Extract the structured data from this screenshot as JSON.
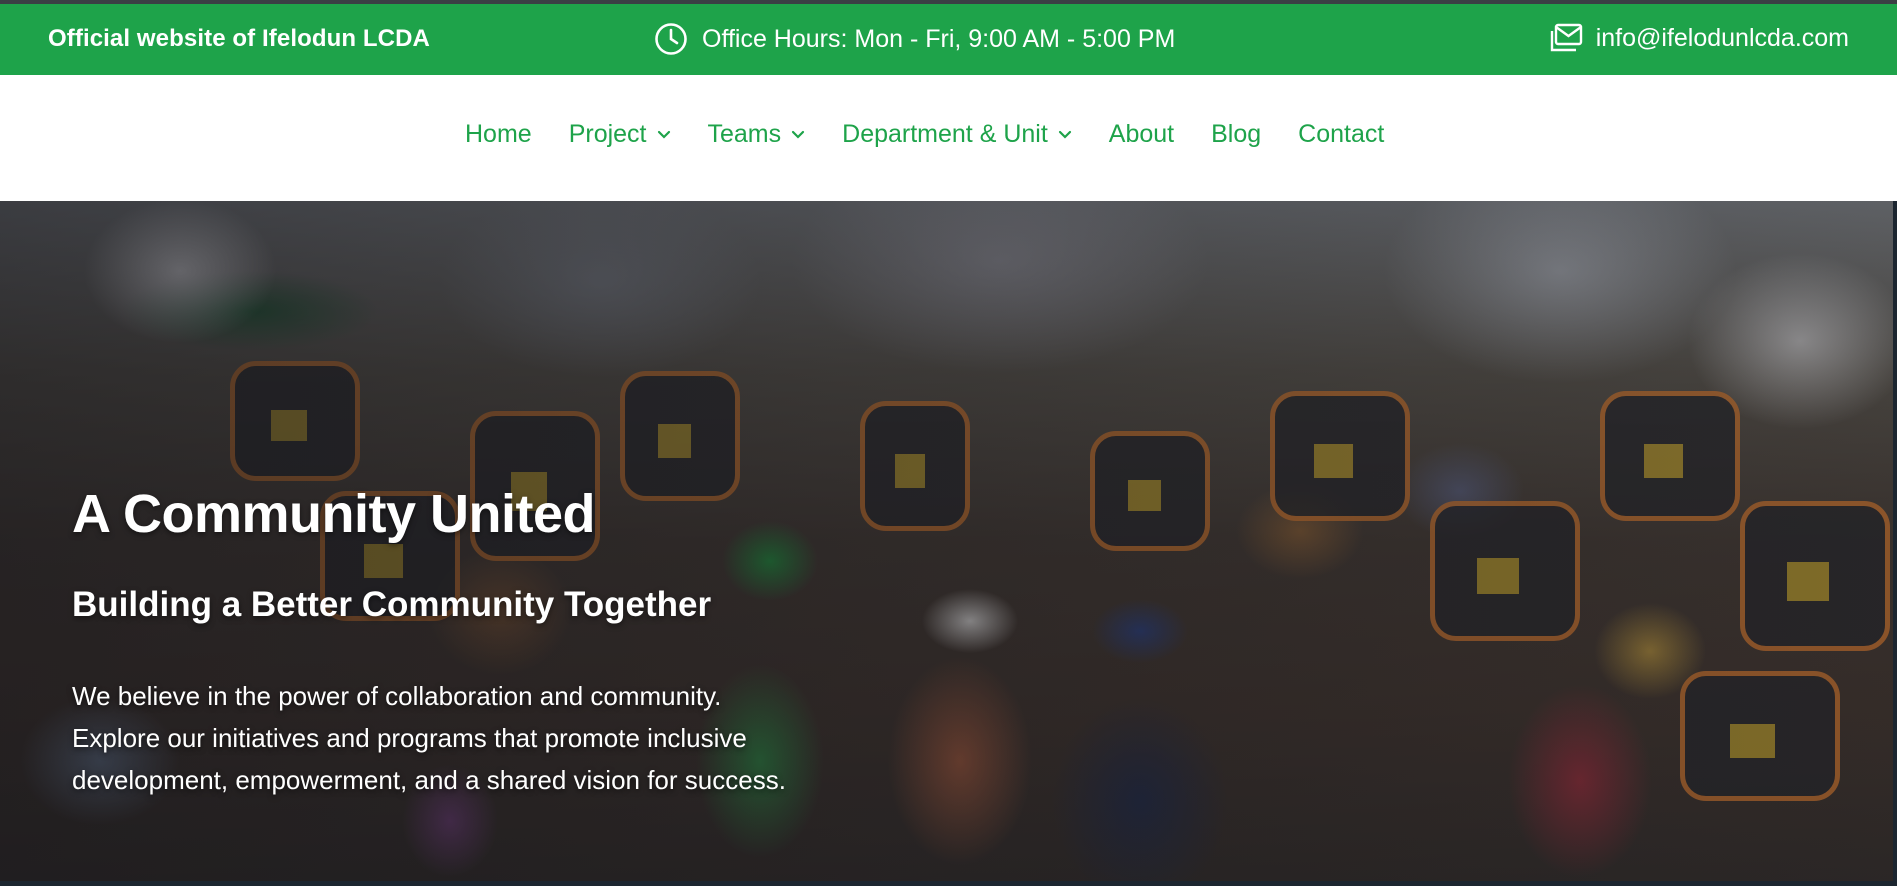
{
  "topbar": {
    "site_title": "Official website of Ifelodun LCDA",
    "office_hours": "Office Hours: Mon - Fri, 9:00 AM - 5:00 PM",
    "email": "info@ifelodunlcda.com",
    "icons": {
      "hours": "clock-icon",
      "email": "envelope-icon"
    },
    "background_color": "#1ea34a"
  },
  "nav": {
    "items": [
      {
        "label": "Home",
        "has_dropdown": false
      },
      {
        "label": "Project",
        "has_dropdown": true
      },
      {
        "label": "Teams",
        "has_dropdown": true
      },
      {
        "label": "Department & Unit",
        "has_dropdown": true
      },
      {
        "label": "About",
        "has_dropdown": false
      },
      {
        "label": "Blog",
        "has_dropdown": false
      },
      {
        "label": "Contact",
        "has_dropdown": false
      }
    ],
    "link_color": "#1ea34a"
  },
  "hero": {
    "title": "A Community United",
    "subtitle": "Building a Better Community Together",
    "body_lines": [
      "We believe in the power of collaboration and community.",
      "Explore our initiatives and programs that promote inclusive",
      "development, empowerment, and a shared vision for success."
    ]
  }
}
